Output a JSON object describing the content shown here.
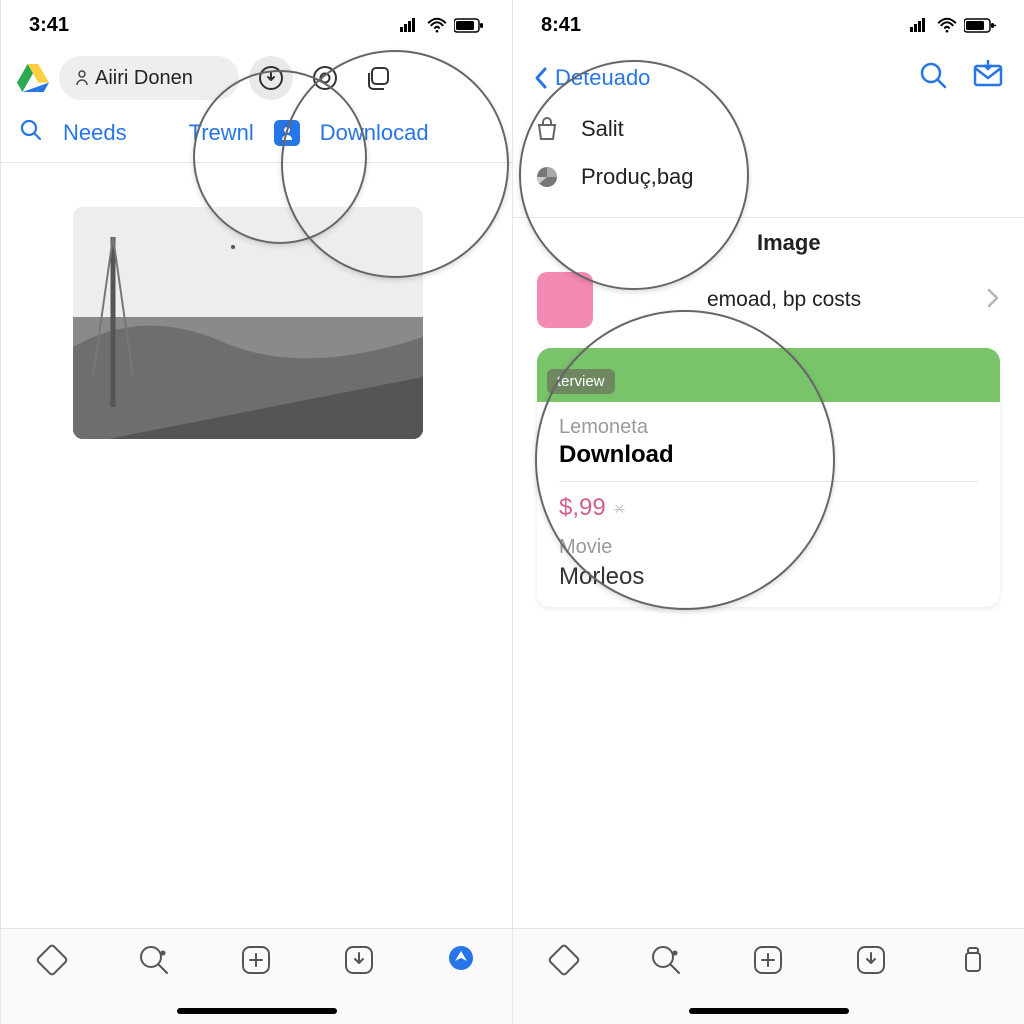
{
  "left": {
    "time": "3:41",
    "account_pill": "Aiiri Donen",
    "tabs": {
      "needs": "Needs",
      "trewnl": "Trewnl",
      "downlocad": "Downlocad"
    }
  },
  "right": {
    "time": "8:41",
    "back_label": "Deteuado",
    "menu": {
      "salit": "Salit",
      "produc": "Produç,bag"
    },
    "section_label": "Image",
    "row_text": "emoad, bp costs",
    "card": {
      "badge": "terview",
      "muted1": "Lemoneta",
      "title1": "Download",
      "price": "$,99",
      "strike": "×",
      "muted2": "Movie",
      "title2": "Morleos"
    }
  }
}
